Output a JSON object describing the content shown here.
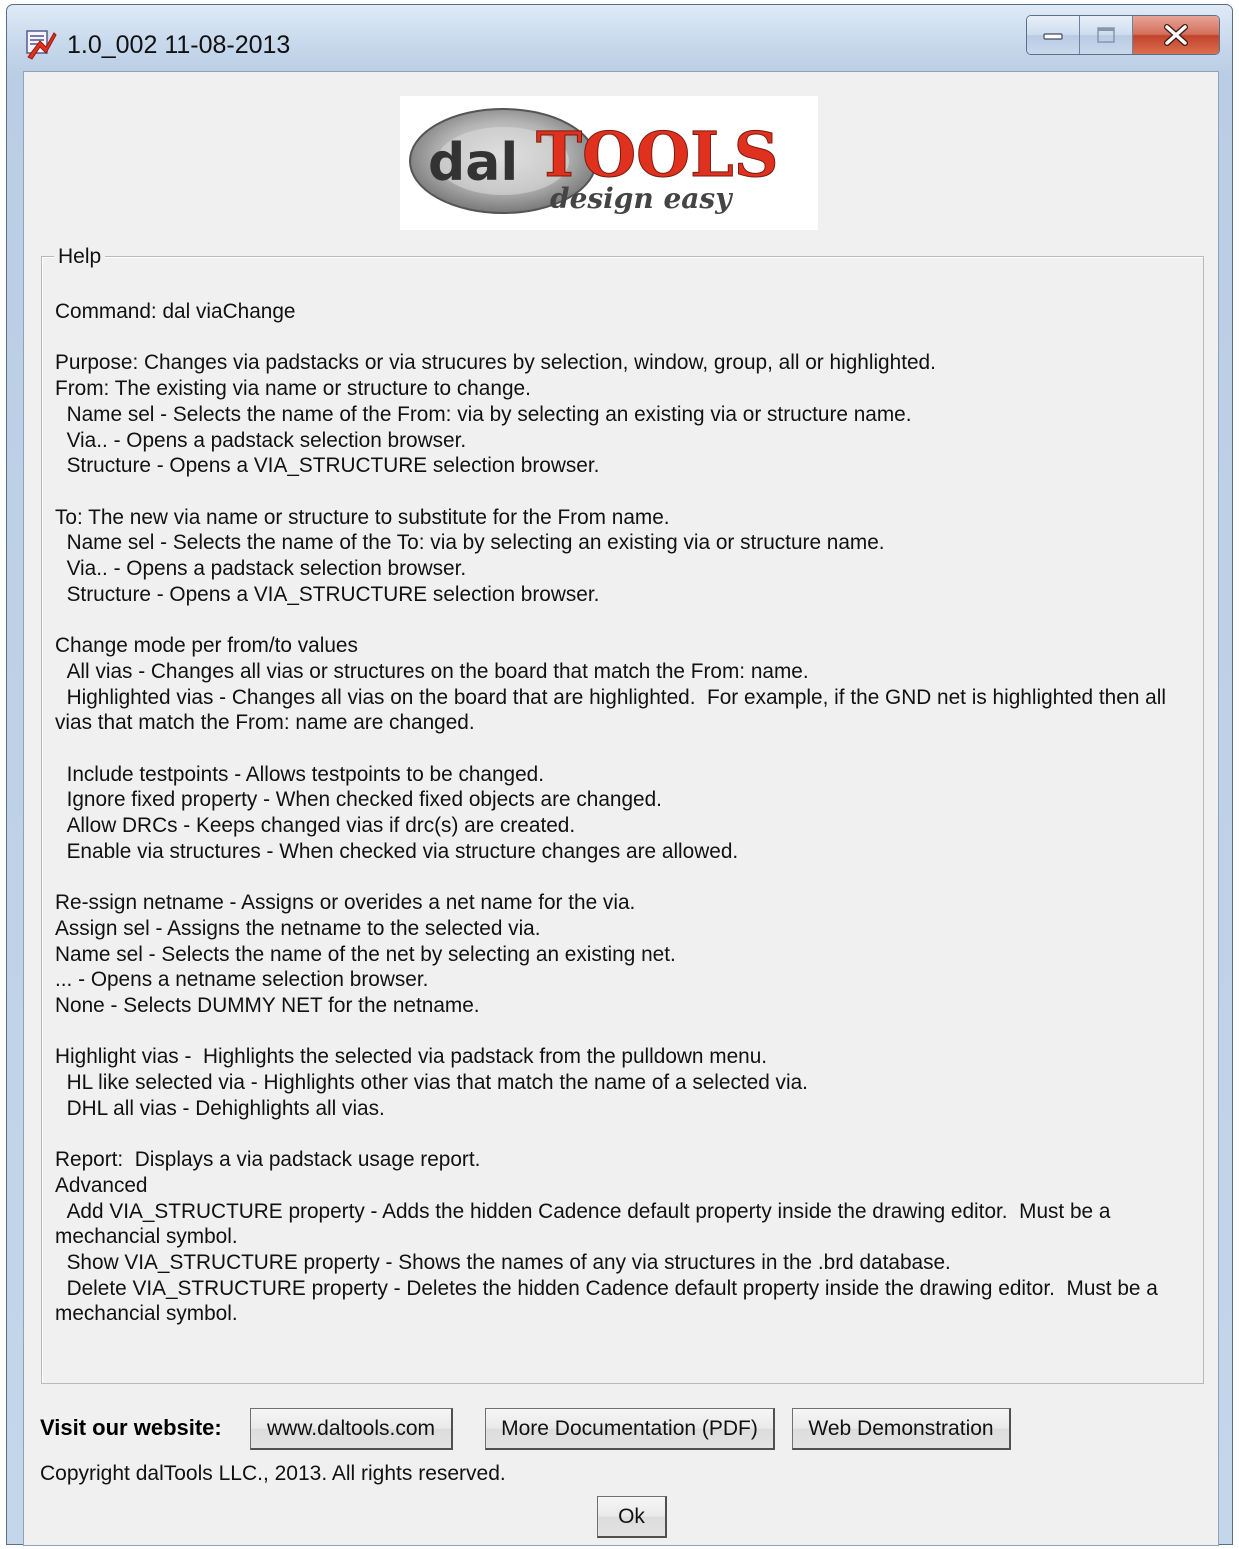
{
  "window": {
    "title": "1.0_002 11-08-2013"
  },
  "logo": {
    "brand_left": "dal",
    "brand_right": "TOOLS",
    "tagline": "design easy"
  },
  "help": {
    "legend": "Help",
    "lines": [
      "Command: dal viaChange",
      "",
      "Purpose: Changes via padstacks or via strucures by selection, window, group, all or highlighted.",
      "From: The existing via name or structure to change.",
      "  Name sel - Selects the name of the From: via by selecting an existing via or structure name.",
      "  Via.. - Opens a padstack selection browser.",
      "  Structure - Opens a VIA_STRUCTURE selection browser.",
      "",
      "To: The new via name or structure to substitute for the From name.",
      "  Name sel - Selects the name of the To: via by selecting an existing via or structure name.",
      "  Via.. - Opens a padstack selection browser.",
      "  Structure - Opens a VIA_STRUCTURE selection browser.",
      "",
      "Change mode per from/to values",
      "  All vias - Changes all vias or structures on the board that match the From: name.",
      "  Highlighted vias - Changes all vias on the board that are highlighted.  For example, if the GND net is highlighted then all",
      "vias that match the From: name are changed.",
      "",
      "  Include testpoints - Allows testpoints to be changed.",
      "  Ignore fixed property - When checked fixed objects are changed.",
      "  Allow DRCs - Keeps changed vias if drc(s) are created.",
      "  Enable via structures - When checked via structure changes are allowed.",
      "",
      "Re-ssign netname - Assigns or overides a net name for the via.",
      "Assign sel - Assigns the netname to the selected via.",
      "Name sel - Selects the name of the net by selecting an existing net.",
      "... - Opens a netname selection browser.",
      "None - Selects DUMMY NET for the netname.",
      "",
      "Highlight vias -  Highlights the selected via padstack from the pulldown menu.",
      "  HL like selected via - Highlights other vias that match the name of a selected via.",
      "  DHL all vias - Dehighlights all vias.",
      "",
      "Report:  Displays a via padstack usage report.",
      "Advanced",
      "  Add VIA_STRUCTURE property - Adds the hidden Cadence default property inside the drawing editor.  Must be a",
      "mechancial symbol.",
      "  Show VIA_STRUCTURE property - Shows the names of any via structures in the .brd database.",
      "  Delete VIA_STRUCTURE property - Deletes the hidden Cadence default property inside the drawing editor.  Must be a",
      "mechancial symbol."
    ]
  },
  "footer": {
    "visit_label": "Visit our website:",
    "website_button": "www.daltools.com",
    "docs_button": "More Documentation (PDF)",
    "demo_button": "Web Demonstration",
    "copyright": "Copyright dalTools LLC., 2013. All rights reserved.",
    "ok_button": "Ok"
  },
  "colors": {
    "brand_red": "#e0301e",
    "brand_dark": "#3a3a3a",
    "titlebar": "#c7d8ec",
    "client_bg": "#f0f0f0"
  }
}
